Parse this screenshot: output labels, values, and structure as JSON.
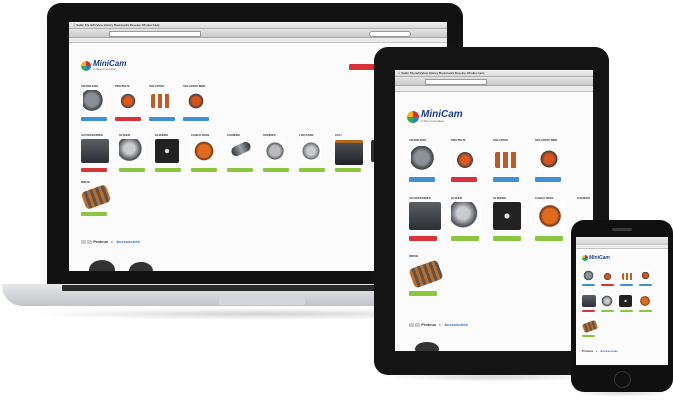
{
  "brand": {
    "logo_text": "MiniCam",
    "logo_sub": "A Pipe Innovation"
  },
  "browser": {
    "menu_items": [
      "Safari",
      "File",
      "Edit",
      "View",
      "History",
      "Bookmarks",
      "Develop",
      "Window",
      "Help"
    ]
  },
  "laptop": {
    "header_button": "",
    "row1": [
      {
        "label": "Crawlers",
        "button_color": "#3d8fd6"
      },
      {
        "label": "Proteus",
        "button_color": "#d8323a"
      },
      {
        "label": "Solopro",
        "button_color": "#3d8fd6"
      },
      {
        "label": "Solopro Mini",
        "button_color": "#3d8fd6"
      }
    ],
    "row2": [
      {
        "label": "Accessories",
        "button_color": "#d8323a"
      },
      {
        "label": "Slider",
        "button_color": "#8cc63f"
      },
      {
        "label": "Sliders",
        "button_color": "#8cc63f"
      },
      {
        "label": "Cable Reel",
        "button_color": "#8cc63f"
      },
      {
        "label": "Camera",
        "button_color": "#8cc63f"
      },
      {
        "label": "Sondes",
        "button_color": "#8cc63f"
      },
      {
        "label": "Locator",
        "button_color": "#8cc63f"
      },
      {
        "label": "CCU",
        "button_color": "#8cc63f"
      }
    ],
    "row3": [
      {
        "label": "Drive",
        "button_color": "#8cc63f"
      }
    ],
    "breadcrumb": {
      "current": "Proteus",
      "link": "Accessories"
    }
  },
  "tablet": {
    "row1": [
      {
        "label": "Crawlers",
        "button_color": "#3d8fd6"
      },
      {
        "label": "Proteus",
        "button_color": "#d8323a"
      },
      {
        "label": "Solopro",
        "button_color": "#3d8fd6"
      },
      {
        "label": "Solopro Mini",
        "button_color": "#3d8fd6"
      }
    ],
    "row2": [
      {
        "label": "Accessories",
        "button_color": "#d8323a"
      },
      {
        "label": "Slider",
        "button_color": "#8cc63f"
      },
      {
        "label": "Sliders",
        "button_color": "#8cc63f"
      },
      {
        "label": "Cable Reel",
        "button_color": "#8cc63f"
      },
      {
        "label": "Camera",
        "button_color": "#8cc63f"
      }
    ],
    "row3": [
      {
        "label": "Drive",
        "button_color": "#8cc63f"
      }
    ],
    "breadcrumb": {
      "current": "Proteus",
      "link": "Accessories"
    }
  },
  "phone": {
    "breadcrumb": {
      "current": "Proteus",
      "link": "Accessories"
    }
  },
  "colors": {
    "accent_blue": "#3d8fd6",
    "accent_red": "#d8323a",
    "accent_green": "#8cc63f",
    "brand_navy": "#1a3f8c"
  }
}
